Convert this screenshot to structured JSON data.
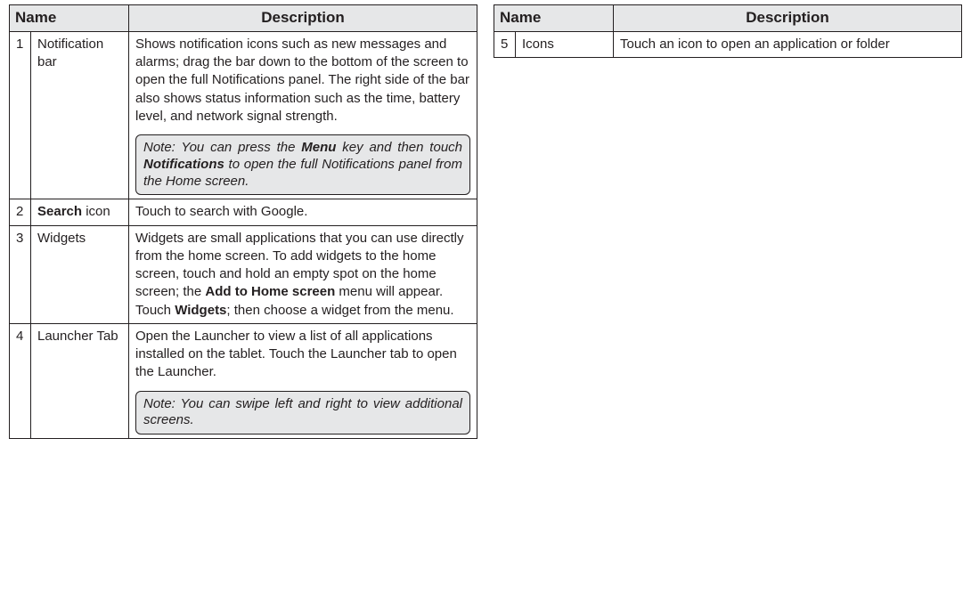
{
  "headers": {
    "name": "Name",
    "description": "Description"
  },
  "left": [
    {
      "num": "1",
      "name": "Notification bar",
      "desc": "Shows notification icons such as new messages and alarms; drag the bar down to the bottom of the screen to open the full Notifications panel. The right side of the bar also shows status information such as the time, battery level, and network signal strength.",
      "note_pre": "Note: You can press the ",
      "note_b1": "Menu",
      "note_mid": " key and then touch ",
      "note_b2": "Notifications",
      "note_post": " to open the full Notifications panel from the Home screen."
    },
    {
      "num": "2",
      "name_b": "Search",
      "name_post": " icon",
      "desc": "Touch to search with Google."
    },
    {
      "num": "3",
      "name": "Widgets",
      "desc_pre": "Widgets are small applications that you can use directly from the home screen. To add widgets to the home screen, touch and hold an empty spot on the home screen; the ",
      "desc_b1": "Add to Home screen",
      "desc_mid": " menu will appear. Touch ",
      "desc_b2": "Widgets",
      "desc_post": "; then choose a widget from the menu."
    },
    {
      "num": "4",
      "name": "Launcher Tab",
      "desc": "Open the Launcher to view a list of all applications installed on the tablet. Touch the Launcher tab to open the Launcher.",
      "note": "Note: You can swipe left and right to view additional screens."
    }
  ],
  "right": [
    {
      "num": "5",
      "name": "Icons",
      "desc": "Touch an icon to open an application or folder"
    }
  ]
}
